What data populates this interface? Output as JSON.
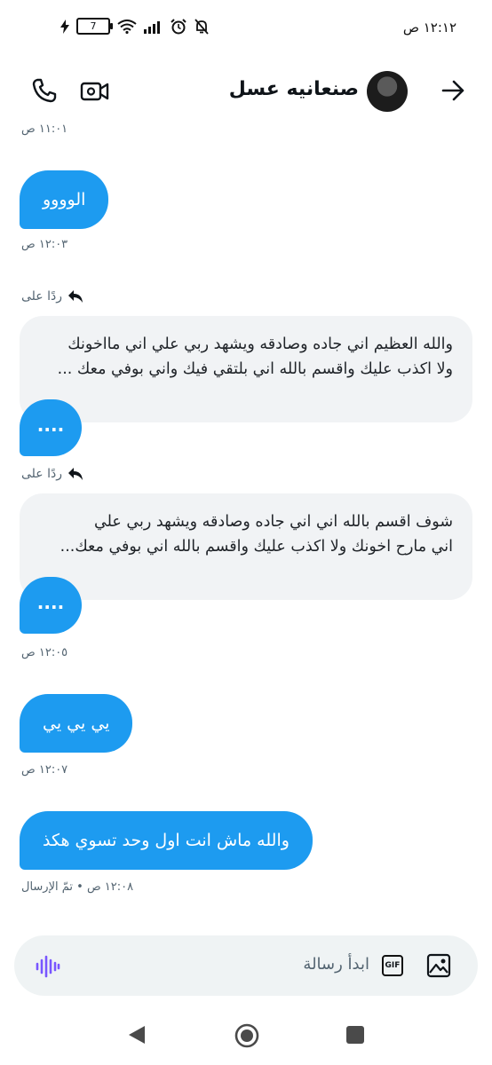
{
  "status_bar": {
    "time": "١٢:١٢ ص",
    "battery": "7"
  },
  "header": {
    "contact_name": "صنعانيه عسل"
  },
  "messages": {
    "ts0": "١١:٠١ ص",
    "m1": "الوووو",
    "ts1": "١٢:٠٣ ص",
    "reply_label": "ردًا على",
    "quote1_line1": "والله العظيم اني جاده وصادقه ويشهد ربي علي اني مااخونك",
    "quote1_line2": "ولا اكذب عليك واقسم بالله اني بلتقي فيك واني بوفي معك ...",
    "dots1": "....",
    "reply_label2": "ردًا على",
    "quote2_line1": "شوف اقسم بالله اني اني جاده وصادقه ويشهد ربي علي",
    "quote2_line2": "اني مارح اخونك ولا اكذب عليك واقسم بالله اني بوفي معك...",
    "dots2": "....",
    "ts2": "١٢:٠٥ ص",
    "m2": "يي يي يي",
    "ts3": "١٢:٠٧ ص",
    "m3": "والله ماش انت اول وحد تسوي هكذ",
    "ts4": "١٢:٠٨ ص • تمّ الإرسال"
  },
  "composer": {
    "placeholder": "ابدأ رسالة",
    "gif_label": "GIF"
  },
  "colors": {
    "accent": "#1d9bf0",
    "quote_bg": "#f1f3f5",
    "composer_bg": "#eff3f4",
    "voice_purple": "#7856ff"
  }
}
